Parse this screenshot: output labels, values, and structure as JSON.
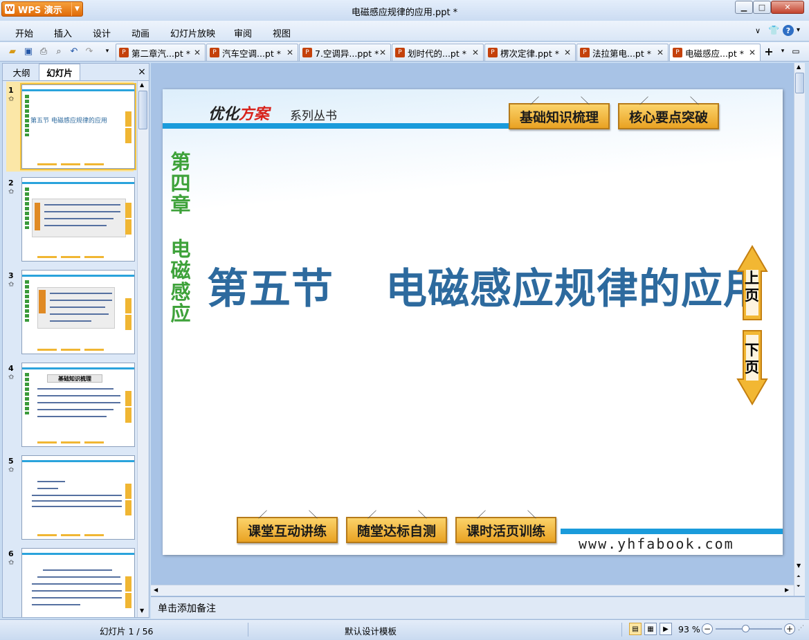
{
  "app": {
    "brand": "WPS 演示",
    "window_title": "电磁感应规律的应用.ppt *"
  },
  "menu": [
    "开始",
    "插入",
    "设计",
    "动画",
    "幻灯片放映",
    "审阅",
    "视图"
  ],
  "doc_tabs": [
    {
      "label": "第二章汽...pt *",
      "active": false
    },
    {
      "label": "汽车空调...pt *",
      "active": false
    },
    {
      "label": "7.空调异...ppt *",
      "active": false
    },
    {
      "label": "划时代的...pt *",
      "active": false
    },
    {
      "label": "楞次定律.ppt *",
      "active": false
    },
    {
      "label": "法拉第电...pt *",
      "active": false
    },
    {
      "label": "电磁感应...pt *",
      "active": true
    }
  ],
  "panel": {
    "tab_outline": "大纲",
    "tab_slides": "幻灯片",
    "close": "×"
  },
  "thumbnails": [
    {
      "num": "1",
      "title": "第五节    电磁感应规律的应用",
      "selected": true
    },
    {
      "num": "2",
      "title": "",
      "selected": false
    },
    {
      "num": "3",
      "title": "",
      "selected": false
    },
    {
      "num": "4",
      "title": "基础知识梳理",
      "selected": false
    },
    {
      "num": "5",
      "title": "",
      "selected": false
    },
    {
      "num": "6",
      "title": "",
      "selected": false
    }
  ],
  "slide": {
    "series_logo_a": "优化",
    "series_logo_b": "方案",
    "series_sub": "系列丛书",
    "top_buttons": [
      "基础知识梳理",
      "核心要点突破"
    ],
    "chapter_chars": [
      "第",
      "四",
      "章"
    ],
    "topic_chars": [
      "电",
      "磁",
      "感",
      "应"
    ],
    "section": "第五节",
    "title": "电磁感应规律的应用",
    "nav_up": [
      "上",
      "页"
    ],
    "nav_down": [
      "下",
      "页"
    ],
    "bottom_buttons": [
      "课堂互动讲练",
      "随堂达标自测",
      "课时活页训练"
    ],
    "url": "www.yhfabook.com"
  },
  "notes_placeholder": "单击添加备注",
  "status": {
    "slide_counter": "幻灯片 1 / 56",
    "template": "默认设计模板",
    "zoom": "93 %"
  },
  "colors": {
    "accent_orange": "#e06a08",
    "slide_title_blue": "#2d6a9e",
    "chapter_green": "#3ea23a",
    "band_blue": "#1a9bdb",
    "board_gold": "#f0b633"
  }
}
